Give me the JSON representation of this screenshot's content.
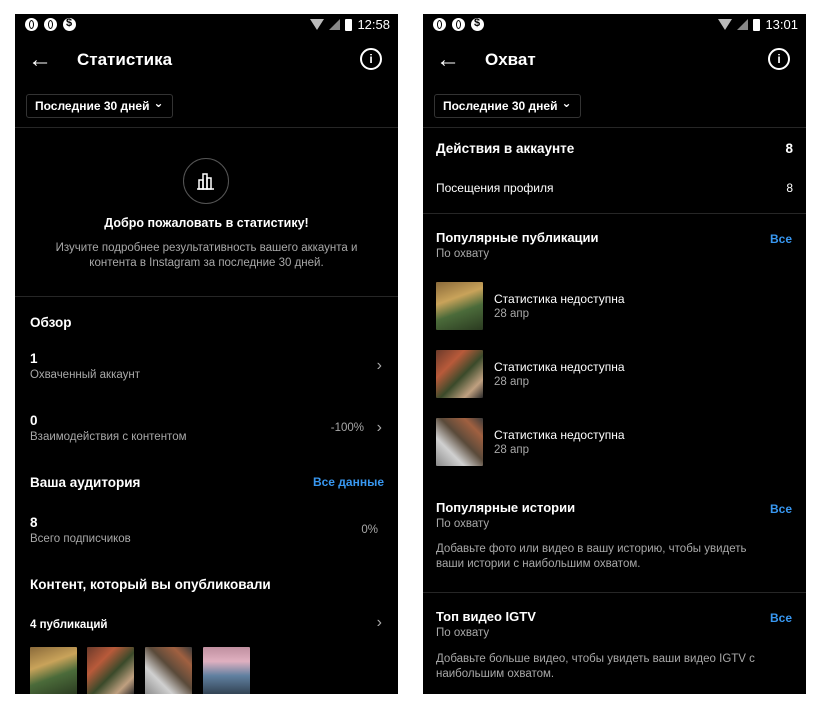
{
  "left": {
    "status": {
      "time": "12:58"
    },
    "title": "Статистика",
    "period": "Последние 30 дней",
    "welcome_title": "Добро пожаловать в статистику!",
    "welcome_text_1": "Изучите подробнее результативность вашего аккаунта и",
    "welcome_text_2": "контента в Instagram за последние 30 дней.",
    "overview_title": "Обзор",
    "reached_value": "1",
    "reached_label": "Охваченный аккаунт",
    "interactions_value": "0",
    "interactions_label": "Взаимодействия с контентом",
    "interactions_change": "-100%",
    "audience_title": "Ваша аудитория",
    "audience_link": "Все данные",
    "followers_value": "8",
    "followers_label": "Всего подписчиков",
    "followers_change": "0%",
    "content_title": "Контент, который вы опубликовали",
    "posts_count": "4 публикаций"
  },
  "right": {
    "status": {
      "time": "13:01"
    },
    "title": "Охват",
    "period": "Последние 30 дней",
    "actions_title": "Действия в аккаунте",
    "actions_value": "8",
    "visits_label": "Посещения профиля",
    "visits_value": "8",
    "popular_posts_title": "Популярные публикации",
    "popular_posts_sub": "По охвату",
    "all_label": "Все",
    "posts": [
      {
        "title": "Статистика недоступна",
        "date": "28 апр"
      },
      {
        "title": "Статистика недоступна",
        "date": "28 апр"
      },
      {
        "title": "Статистика недоступна",
        "date": "28 апр"
      }
    ],
    "stories_title": "Популярные истории",
    "stories_sub": "По охвату",
    "stories_text_1": "Добавьте фото или видео в вашу историю, чтобы увидеть",
    "stories_text_2": "ваши истории с наибольшим охватом.",
    "igtv_title": "Топ видео IGTV",
    "igtv_sub": "По охвату",
    "igtv_text_1": "Добавьте больше видео, чтобы увидеть ваши видео IGTV с",
    "igtv_text_2": "наибольшим охватом."
  },
  "icons": {
    "back": "←",
    "info": "i",
    "chevron_down": "⌄",
    "chevron_right": "›"
  }
}
